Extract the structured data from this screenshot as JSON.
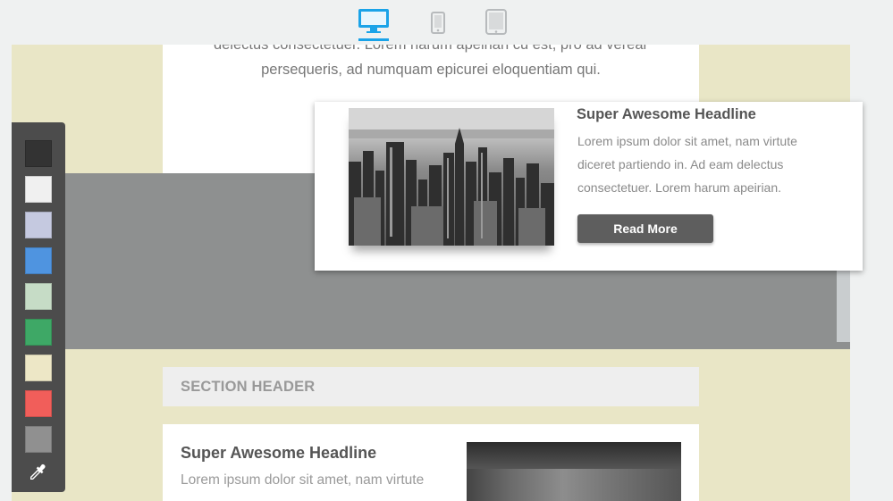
{
  "device_toolbar": {
    "devices": [
      {
        "name": "desktop",
        "icon": "desktop-icon",
        "active": true
      },
      {
        "name": "mobile",
        "icon": "mobile-phone-icon",
        "active": false
      },
      {
        "name": "tablet",
        "icon": "tablet-icon",
        "active": false
      }
    ],
    "active_color": "#1aa3e8",
    "inactive_color": "#b7babc"
  },
  "intro": {
    "line1": "delectus consectetuer. Lorem harum apeirian cu est, pro ad verear",
    "line2": "persequeris, ad numquam epicurei eloquentiam qui."
  },
  "dragged_card": {
    "image": "city-skyline-photo",
    "headline": "Super Awesome Headline",
    "body": "Lorem ipsum dolor sit amet, nam virtute diceret partiendo in. Ad eam delectus consectetuer. Lorem harum apeirian.",
    "button_label": "Read More"
  },
  "section_header": {
    "title": "SECTION HEADER"
  },
  "article": {
    "headline": "Super Awesome Headline",
    "body": "Lorem ipsum dolor sit amet, nam virtute",
    "image": "blurred-office-photo"
  },
  "palette": {
    "swatches": [
      "#333333",
      "#f0f0f0",
      "#c5c9e0",
      "#4f94e0",
      "#c6dcc6",
      "#3ea866",
      "#ede7c6",
      "#f15e5a",
      "#909090"
    ],
    "picker_icon": "eyedropper-icon"
  },
  "colors": {
    "canvas_bg": "#e9e6c6",
    "drop_band": "#8e9090",
    "button": "#5e5e5e"
  }
}
